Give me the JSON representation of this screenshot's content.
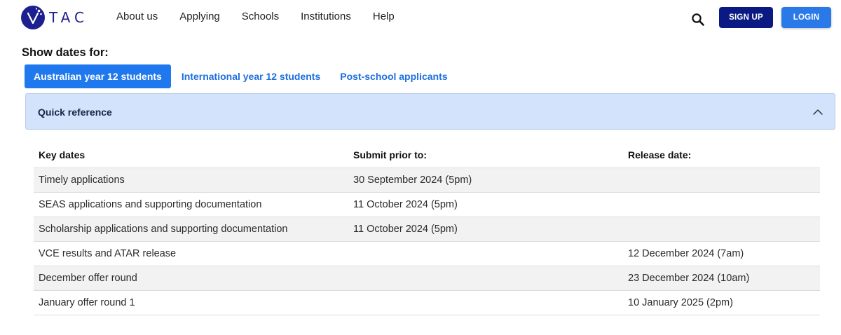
{
  "header": {
    "logo_text": "TAC",
    "nav": [
      "About us",
      "Applying",
      "Schools",
      "Institutions",
      "Help"
    ],
    "signup_label": "SIGN UP",
    "login_label": "LOGIN",
    "colors": {
      "brand": "#1c1f8f",
      "signup": "#0b1a82",
      "login": "#2979e8"
    }
  },
  "filter": {
    "heading": "Show dates for:",
    "tabs": [
      {
        "label": "Australian year 12 students",
        "active": true
      },
      {
        "label": "International year 12 students",
        "active": false
      },
      {
        "label": "Post-school applicants",
        "active": false
      }
    ]
  },
  "accordion": {
    "title": "Quick reference",
    "expanded": true,
    "icon": "chevron-up-icon"
  },
  "table": {
    "headers": [
      "Key dates",
      "Submit prior to:",
      "Release date:"
    ],
    "rows": [
      [
        "Timely applications",
        "30 September 2024 (5pm)",
        ""
      ],
      [
        "SEAS applications and supporting documentation",
        "11 October 2024 (5pm)",
        ""
      ],
      [
        "Scholarship applications and supporting documentation",
        "11 October 2024 (5pm)",
        ""
      ],
      [
        "VCE results and ATAR release",
        "",
        "12 December 2024 (7am)"
      ],
      [
        "December offer round",
        "",
        "23 December 2024 (10am)"
      ],
      [
        "January offer round 1",
        "",
        "10 January 2025 (2pm)"
      ]
    ]
  }
}
